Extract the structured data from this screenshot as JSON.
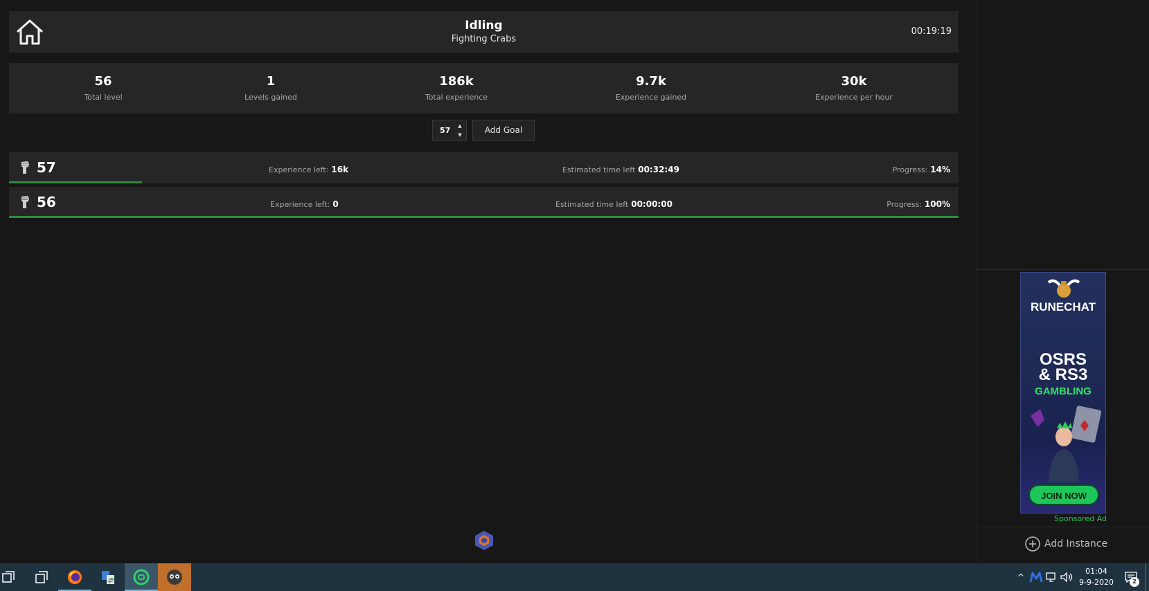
{
  "header": {
    "title": "Idling",
    "subtitle": "Fighting Crabs",
    "timer": "00:19:19"
  },
  "stats": [
    {
      "value": "56",
      "label": "Total level"
    },
    {
      "value": "1",
      "label": "Levels gained"
    },
    {
      "value": "186k",
      "label": "Total experience"
    },
    {
      "value": "9.7k",
      "label": "Experience gained"
    },
    {
      "value": "30k",
      "label": "Experience per hour"
    }
  ],
  "goal_controls": {
    "input_value": "57",
    "add_label": "Add Goal"
  },
  "goals": [
    {
      "level": "57",
      "exp_left_label": "Experience left:",
      "exp_left": "16k",
      "time_label": "Estimated time left",
      "time_left": "00:32:49",
      "progress_label": "Progress:",
      "progress": "14%",
      "progress_fraction": 0.14
    },
    {
      "level": "56",
      "exp_left_label": "Experience left:",
      "exp_left": "0",
      "time_label": "Estimated time left",
      "time_left": "00:00:00",
      "progress_label": "Progress:",
      "progress": "100%",
      "progress_fraction": 1.0
    }
  ],
  "sidebar": {
    "ad": {
      "brand": "RUNECHAT",
      "line1": "OSRS",
      "line2": "& RS3",
      "line3": "GAMBLING",
      "cta": "JOIN NOW"
    },
    "sponsored_label": "Sponsored Ad",
    "add_instance_label": "Add Instance"
  },
  "taskbar": {
    "clock_time": "01:04",
    "clock_date": "9-9-2020",
    "notification_count": "2",
    "apps": [
      "task-view",
      "window-switcher",
      "firefox",
      "file-transfer",
      "runelite-client",
      "osrs-client"
    ]
  },
  "colors": {
    "progress_green": "#2e8b3d",
    "panel": "#262626",
    "background": "#171717",
    "taskbar": "#1f3240"
  }
}
